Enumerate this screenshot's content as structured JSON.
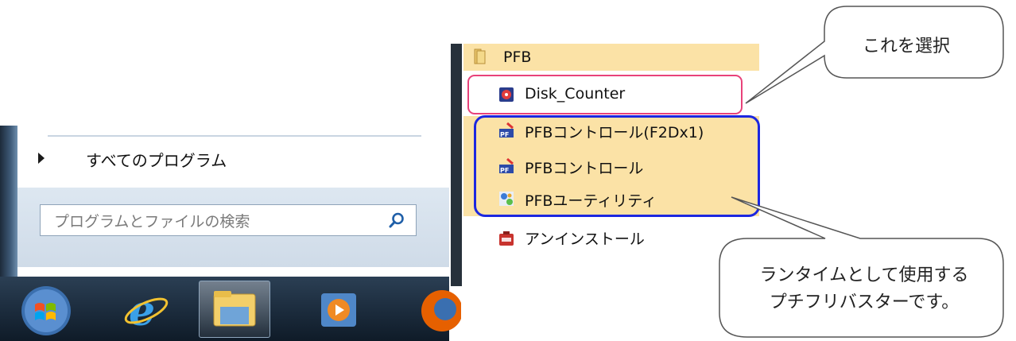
{
  "start_menu": {
    "all_programs_label": "すべてのプログラム",
    "search_placeholder": "プログラムとファイルの検索"
  },
  "taskbar": {
    "items": [
      "start-orb",
      "internet-explorer",
      "windows-explorer",
      "windows-media-player",
      "firefox"
    ]
  },
  "program_menu": {
    "folder_label": "PFB",
    "items": [
      {
        "label": "Disk_Counter",
        "icon": "disk-counter-icon"
      },
      {
        "label": "PFBコントロール(F2Dx1)",
        "icon": "pfb-control-icon"
      },
      {
        "label": "PFBコントロール",
        "icon": "pfb-control-icon"
      },
      {
        "label": "PFBユーティリティ",
        "icon": "pfb-utility-icon"
      },
      {
        "label": "アンインストール",
        "icon": "uninstall-icon"
      }
    ]
  },
  "callouts": {
    "select_this": "これを選択",
    "runtime_line1": "ランタイムとして使用する",
    "runtime_line2": "プチフリバスターです。"
  },
  "colors": {
    "highlight": "#fbe2a6",
    "red_outline": "#e8427a",
    "blue_outline": "#1c27e0"
  }
}
